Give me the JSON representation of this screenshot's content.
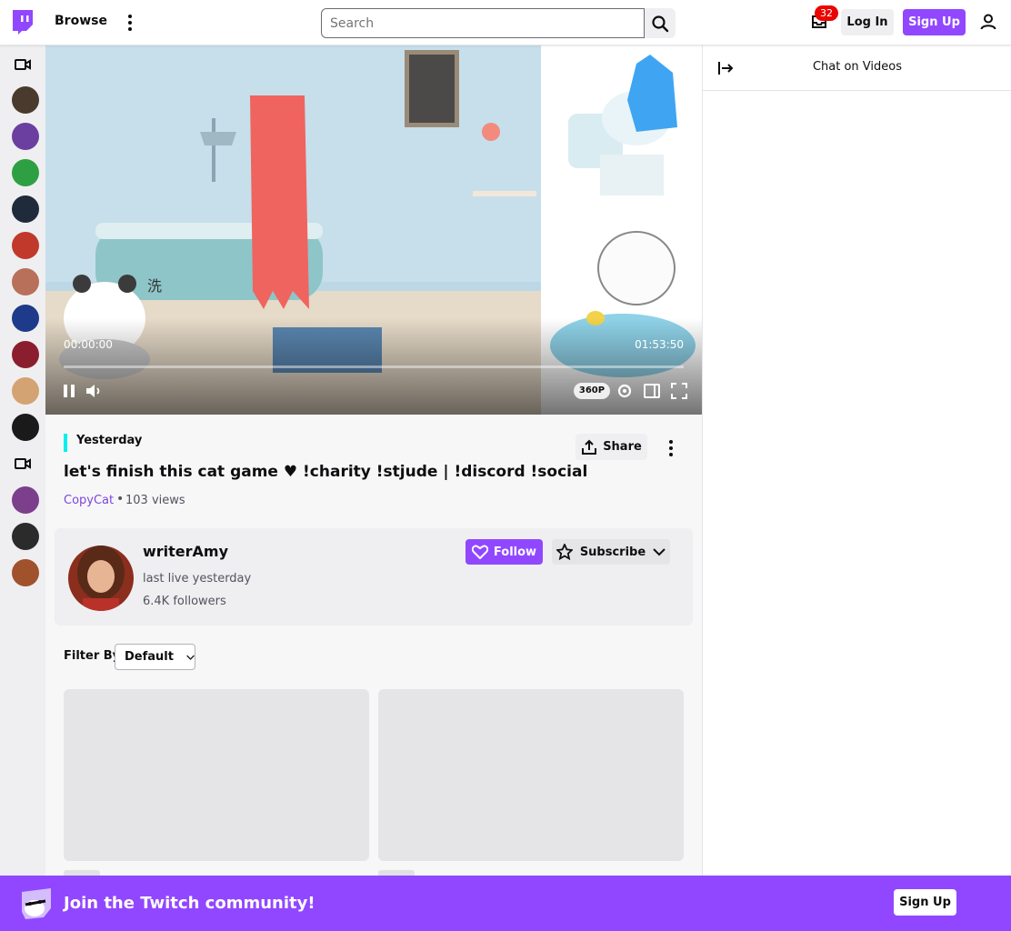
{
  "nav": {
    "browse_label": "Browse",
    "search_placeholder": "Search",
    "inbox_count": "32",
    "login_label": "Log In",
    "signup_label": "Sign Up"
  },
  "sidebar": {
    "avatars": [
      {
        "color": "#4a3a2e"
      },
      {
        "color": "#6b3fa0"
      },
      {
        "color": "#2ea043"
      },
      {
        "color": "#1f2a3a"
      },
      {
        "color": "#c0392b"
      },
      {
        "color": "#b8705a"
      },
      {
        "color": "#1e3a8a"
      },
      {
        "color": "#8b1e2e"
      },
      {
        "color": "#d4a373"
      },
      {
        "color": "#1a1a1a"
      },
      {
        "color": "#7c3f8c"
      },
      {
        "color": "#2b2b2b"
      },
      {
        "color": "#a0522d"
      }
    ]
  },
  "player": {
    "time_current": "00:00:00",
    "time_total": "01:53:50",
    "progress_fraction": 0.0,
    "quality": "360P"
  },
  "chat": {
    "title": "Chat on Videos"
  },
  "video_info": {
    "date": "Yesterday",
    "title": "let's finish this cat game ♥ !charity !stjude | !discord !social",
    "category": "CopyCat",
    "separator": "•",
    "views": "103 views",
    "share_label": "Share"
  },
  "channel": {
    "name": "writerAmy",
    "last_live": "last live yesterday",
    "followers": "6.4K followers",
    "follow_label": "Follow",
    "subscribe_label": "Subscribe"
  },
  "filter": {
    "label": "Filter By",
    "selected": "Default"
  },
  "banner": {
    "text": "Join the Twitch community!",
    "button_label": "Sign Up"
  },
  "colors": {
    "brand": "#9147ff",
    "date_accent": "#00f0f0",
    "badge": "#eb0400"
  }
}
